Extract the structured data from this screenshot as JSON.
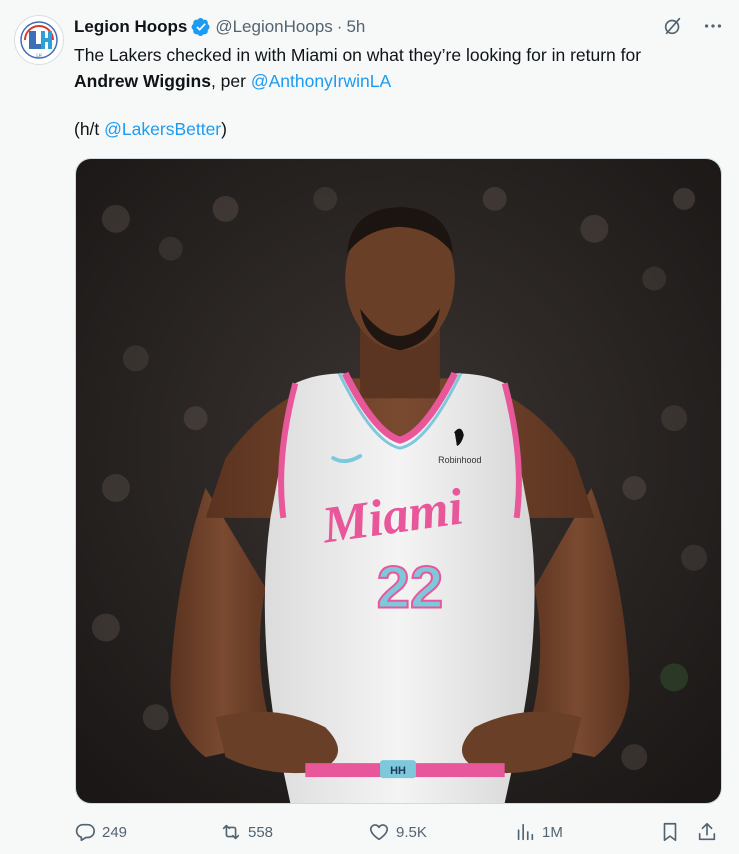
{
  "author": {
    "name": "Legion Hoops",
    "handle": "@LegionHoops",
    "separator": "·",
    "time": "5h",
    "avatar_text": "LH"
  },
  "tweet": {
    "line1": "The Lakers checked in with Miami on what they’re looking for in return for",
    "bold_name": "Andrew Wiggins",
    "line2_after": ", per ",
    "mention1": "@AnthonyIrwinLA",
    "ht_prefix": "(h/t ",
    "mention2": "@LakersBetter",
    "ht_suffix": ")"
  },
  "media": {
    "jersey_text": "Miami",
    "jersey_number": "22",
    "sponsor": "Robinhood",
    "belt": "HH"
  },
  "actions": {
    "replies": "249",
    "reposts": "558",
    "likes": "9.5K",
    "views": "1M"
  },
  "colors": {
    "accent": "#1d9bf0",
    "muted": "#536471",
    "jersey_pink": "#e8579a",
    "jersey_blue": "#7ec8dc"
  }
}
